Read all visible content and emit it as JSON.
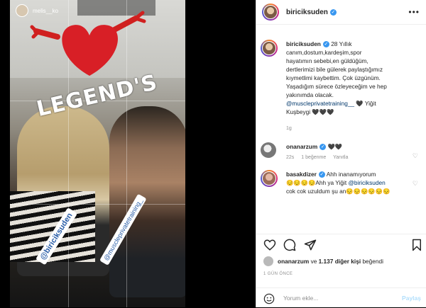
{
  "story": {
    "username": "melis__ko",
    "overlay_title": "LEGEND'S",
    "sticker_a": "@biriciksuden",
    "sticker_b": "@muscleprivatetraining_"
  },
  "post": {
    "author": "biriciksuden",
    "caption_lines": [
      "28 Yıllık",
      "canım,dostum,kardeşim,spor",
      "hayatımın sebebi,en güldüğüm,",
      "dertlerimizi bile gülerek paylaştığımız",
      "kıymetlimi kaybettim. Çok üzgünüm.",
      "Yaşadığım sürece özleyeceğim ve hep",
      "yakınımda olacak."
    ],
    "caption_mention": "@muscleprivatetraining__",
    "caption_tail": " 🖤 Yiğit",
    "caption_last": "Kuşbeygi 🖤🖤🖤",
    "caption_age": "1g"
  },
  "comments": [
    {
      "user": "onanarzum",
      "text": "🖤🖤",
      "age": "22s",
      "likes": "1 beğenme",
      "reply": "Yanıtla"
    },
    {
      "user": "basakdizer",
      "text1": "Ahh inanamıyorum",
      "text2": "😔😔😔😔Ahh ya Yiğit ",
      "mention": "@biriciksuden",
      "text3": "cok cok uzuldum şu an😔😔😔😔😔😔"
    }
  ],
  "likes": {
    "user": "onanarzum",
    "connector": " ve ",
    "others": "1.137 diğer kişi",
    "suffix": " beğendi"
  },
  "time_ago": "1 GÜN ÖNCE",
  "add_comment": {
    "placeholder": "Yorum ekle...",
    "post_label": "Paylaş"
  },
  "colors": {
    "verified": "#3897f0",
    "mention": "#00376b",
    "post_disabled": "#b2dffc"
  }
}
